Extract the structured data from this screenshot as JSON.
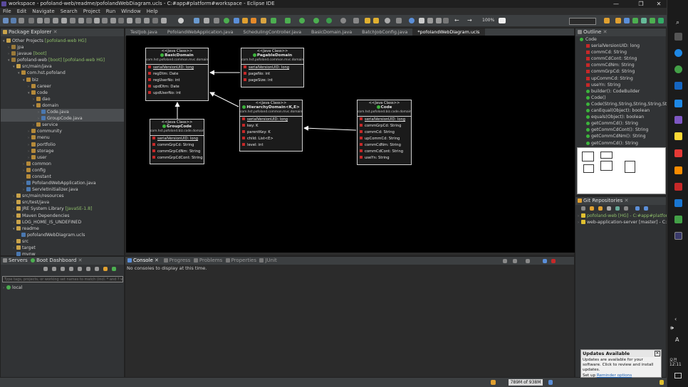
{
  "window": {
    "title": "workspace - pofoland-web/readme/pofolandWebDiagram.ucls - C:#app#platform#workspace - Eclipse IDE",
    "controls": [
      "—",
      "❐",
      "✕"
    ]
  },
  "menu": [
    "File",
    "Edit",
    "Navigate",
    "Search",
    "Project",
    "Run",
    "Window",
    "Help"
  ],
  "toolbar": {
    "zoom": "100%"
  },
  "package_explorer": {
    "title": "Package Explorer",
    "items": [
      {
        "indent": 0,
        "arrow": "▾",
        "icon": "folder",
        "label": "Other Projects",
        "extra": "[pofoland-web HG]"
      },
      {
        "indent": 1,
        "arrow": "›",
        "icon": "proj",
        "label": "jpa",
        "extra": ""
      },
      {
        "indent": 1,
        "arrow": "›",
        "icon": "proj",
        "label": "javaue",
        "extra": "[boot]"
      },
      {
        "indent": 1,
        "arrow": "▾",
        "icon": "proj",
        "label": "pofoland-web",
        "extra": "[boot] [pofoland-web HG]"
      },
      {
        "indent": 2,
        "arrow": "▾",
        "icon": "folder",
        "label": "src/main/java",
        "extra": ""
      },
      {
        "indent": 3,
        "arrow": "▾",
        "icon": "pkg",
        "label": "com.hst.pofoland",
        "extra": ""
      },
      {
        "indent": 4,
        "arrow": "▾",
        "icon": "pkg",
        "label": "biz",
        "extra": ""
      },
      {
        "indent": 5,
        "arrow": "›",
        "icon": "pkg",
        "label": "career",
        "extra": ""
      },
      {
        "indent": 5,
        "arrow": "▾",
        "icon": "pkg",
        "label": "code",
        "extra": ""
      },
      {
        "indent": 6,
        "arrow": "›",
        "icon": "pkg",
        "label": "dao",
        "extra": ""
      },
      {
        "indent": 6,
        "arrow": "▾",
        "icon": "pkg",
        "label": "domain",
        "extra": ""
      },
      {
        "indent": 7,
        "arrow": "›",
        "icon": "jfile",
        "label": "Code.java",
        "extra": "",
        "selected": true
      },
      {
        "indent": 7,
        "arrow": "›",
        "icon": "jfile",
        "label": "GroupCode.java",
        "extra": "",
        "selected": true
      },
      {
        "indent": 6,
        "arrow": "›",
        "icon": "pkg",
        "label": "service",
        "extra": ""
      },
      {
        "indent": 5,
        "arrow": "›",
        "icon": "pkg",
        "label": "community",
        "extra": ""
      },
      {
        "indent": 5,
        "arrow": "›",
        "icon": "pkg",
        "label": "menu",
        "extra": ""
      },
      {
        "indent": 5,
        "arrow": "›",
        "icon": "pkg",
        "label": "portfolio",
        "extra": ""
      },
      {
        "indent": 5,
        "arrow": "›",
        "icon": "pkg",
        "label": "storage",
        "extra": ""
      },
      {
        "indent": 5,
        "arrow": "›",
        "icon": "pkg",
        "label": "user",
        "extra": ""
      },
      {
        "indent": 4,
        "arrow": "›",
        "icon": "pkg",
        "label": "common",
        "extra": ""
      },
      {
        "indent": 4,
        "arrow": "›",
        "icon": "pkg",
        "label": "config",
        "extra": ""
      },
      {
        "indent": 4,
        "arrow": "",
        "icon": "pkg",
        "label": "constant",
        "extra": ""
      },
      {
        "indent": 4,
        "arrow": "›",
        "icon": "jfile",
        "label": "PofolandWebApplication.java",
        "extra": ""
      },
      {
        "indent": 4,
        "arrow": "›",
        "icon": "jfile",
        "label": "ServletInitializer.java",
        "extra": ""
      },
      {
        "indent": 2,
        "arrow": "›",
        "icon": "folder",
        "label": "src/main/resources",
        "extra": ""
      },
      {
        "indent": 2,
        "arrow": "›",
        "icon": "folder",
        "label": "src/test/java",
        "extra": ""
      },
      {
        "indent": 2,
        "arrow": "›",
        "icon": "folder",
        "label": "JRE System Library",
        "extra": "[JavaSE-1.8]"
      },
      {
        "indent": 2,
        "arrow": "›",
        "icon": "folder",
        "label": "Maven Dependencies",
        "extra": ""
      },
      {
        "indent": 2,
        "arrow": "›",
        "icon": "folder",
        "label": "LOG_HOME_IS_UNDEFINED",
        "extra": ""
      },
      {
        "indent": 2,
        "arrow": "▾",
        "icon": "folder",
        "label": "readme",
        "extra": ""
      },
      {
        "indent": 3,
        "arrow": "",
        "icon": "jfile",
        "label": "pofolandWebDiagram.ucls",
        "extra": ""
      },
      {
        "indent": 2,
        "arrow": "›",
        "icon": "folder",
        "label": "src",
        "extra": ""
      },
      {
        "indent": 2,
        "arrow": "›",
        "icon": "folder",
        "label": "target",
        "extra": ""
      },
      {
        "indent": 2,
        "arrow": "",
        "icon": "jfile",
        "label": "mvnw",
        "extra": ""
      }
    ]
  },
  "editor_tabs": [
    "TestJob.java",
    "PofolandWebApplication.java",
    "SchedulingController.java",
    "BasicDomain.java",
    "BatchJobConfig.java",
    "*pofolandWebDiagram.ucls"
  ],
  "diagram": {
    "classes": [
      {
        "stereo": "<<Java Class>>",
        "name": "BasicDomain",
        "pkg": "com.hst.pofoland.common.mvc.domain",
        "fields": [
          "serialVersionUID: long",
          "regDtm: Date",
          "regUserNo: int",
          "updDtm: Date",
          "updUserNo: int"
        ]
      },
      {
        "stereo": "<<Java Class>>",
        "name": "PagableDomain",
        "pkg": "com.hst.pofoland.common.mvc.domain",
        "fields": [
          "serialVersionUID: long",
          "pageNo: int",
          "pageSize: int"
        ]
      },
      {
        "stereo": "<<Java Class>>",
        "name": "HierarchyDomain<K,E>",
        "pkg": "com.hst.pofoland.common.mvc.domain",
        "fields": [
          "serialVersionUID: long",
          "key: K",
          "parentKey: K",
          "child: List<E>",
          "level: int"
        ]
      },
      {
        "stereo": "<<Java Class>>",
        "name": "GroupCode",
        "pkg": "com.hst.pofoland.biz.code.domain",
        "fields": [
          "serialVersionUID: long",
          "commGrpCd: String",
          "commGrpCdNm: String",
          "commGrpCdCont: String"
        ]
      },
      {
        "stereo": "<<Java Class>>",
        "name": "Code",
        "pkg": "com.hst.pofoland.biz.code.domain",
        "fields": [
          "serialVersionUID: long",
          "commGrpCd: String",
          "commCd: String",
          "upCommCd: String",
          "commCdNm: String",
          "commCdCont: String",
          "useYn: String"
        ]
      }
    ]
  },
  "outline": {
    "title": "Outline",
    "root": "Code",
    "items": [
      {
        "kind": "field",
        "label": "serialVersionUID: long"
      },
      {
        "kind": "field",
        "label": "commCd: String"
      },
      {
        "kind": "field",
        "label": "commCdCont: String"
      },
      {
        "kind": "field",
        "label": "commCdNm: String"
      },
      {
        "kind": "field",
        "label": "commGrpCd: String"
      },
      {
        "kind": "field",
        "label": "upCommCd: String"
      },
      {
        "kind": "field",
        "label": "useYn: String"
      },
      {
        "kind": "method",
        "label": "builder(): CodeBuilder"
      },
      {
        "kind": "method",
        "label": "Code()"
      },
      {
        "kind": "method",
        "label": "Code(String,String,String,String,String)"
      },
      {
        "kind": "method",
        "label": "canEqual(Object): boolean"
      },
      {
        "kind": "method",
        "label": "equals(Object): boolean"
      },
      {
        "kind": "method",
        "label": "getCommCd(): String"
      },
      {
        "kind": "method",
        "label": "getCommCdCont(): String"
      },
      {
        "kind": "method",
        "label": "getCommCdNm(): String"
      },
      {
        "kind": "method",
        "label": "getCommCd(): String"
      }
    ]
  },
  "git": {
    "title": "Git Repositories",
    "items": [
      "pofoland-web [HG] - C:#app#platfor",
      "web-application-server [master] - C:#"
    ]
  },
  "servers": {
    "tab1": "Servers",
    "tab2": "Boot Dashboard",
    "filter_placeholder": "Type tags, projects, or working set names to match (incl. * and ? wildcards)",
    "item": "local"
  },
  "console": {
    "tabs": [
      "Console",
      "Progress",
      "Problems",
      "Properties",
      "JUnit"
    ],
    "message": "No consoles to display at this time."
  },
  "notification": {
    "title": "Updates Available",
    "body": "Updates are available for your software. Click to review and install updates.",
    "footer_prefix": "Set up",
    "footer_link": "Reminder options"
  },
  "status": {
    "memory": "789M of 938M"
  },
  "taskbar": {
    "time": "오전 12:11",
    "lang": "A",
    "volume": "🕪"
  }
}
